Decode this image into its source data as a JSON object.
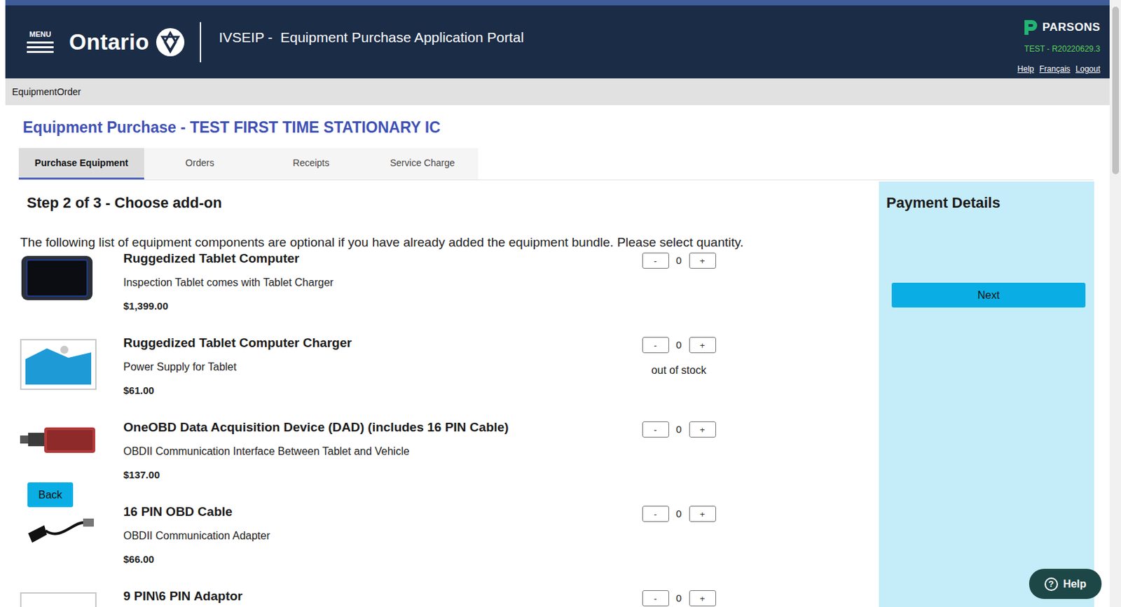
{
  "header": {
    "menu_label": "MENU",
    "brand": "Ontario",
    "portal_title": "IVSEIP -  Equipment Purchase Application Portal",
    "company": "PARSONS",
    "environment": "TEST - R20220629.3",
    "links": [
      "Help",
      "Français",
      "Logout"
    ]
  },
  "breadcrumb": "EquipmentOrder",
  "page_title": "Equipment Purchase - TEST FIRST TIME STATIONARY IC",
  "tabs": [
    {
      "label": "Purchase Equipment",
      "selected": true
    },
    {
      "label": "Orders",
      "selected": false
    },
    {
      "label": "Receipts",
      "selected": false
    },
    {
      "label": "Service Charge",
      "selected": false
    }
  ],
  "step": {
    "title": "Step 2 of 3 - Choose add-on",
    "instructions": "The following list of equipment components are optional if you have already added the equipment bundle. Please select quantity."
  },
  "items": [
    {
      "kind": "tablet",
      "name": "Ruggedized Tablet Computer",
      "description": "Inspection Tablet comes with Tablet Charger",
      "price": "$1,399.00",
      "quantity": "0",
      "minus": "-",
      "plus": "+"
    },
    {
      "kind": "placeholder",
      "name": "Ruggedized Tablet Computer Charger",
      "description": "Power Supply for Tablet",
      "price": "$61.00",
      "quantity": "0",
      "minus": "-",
      "plus": "+",
      "stock_note": "out of stock"
    },
    {
      "kind": "device",
      "name": "OneOBD Data Acquisition Device (DAD) (includes 16 PIN Cable)",
      "description": "OBDII Communication Interface Between Tablet and Vehicle",
      "price": "$137.00",
      "quantity": "0",
      "minus": "-",
      "plus": "+"
    },
    {
      "kind": "cable",
      "name": "16 PIN OBD Cable",
      "description": "OBDII Communication Adapter",
      "price": "$66.00",
      "quantity": "0",
      "minus": "-",
      "plus": "+"
    },
    {
      "kind": "adapter",
      "name": "9 PIN\\6 PIN Adaptor",
      "quantity": "0",
      "minus": "-",
      "plus": "+"
    }
  ],
  "back_button": "Back",
  "payment": {
    "title": "Payment Details",
    "next_button": "Next"
  },
  "help_button": {
    "icon": "?",
    "label": "Help"
  }
}
